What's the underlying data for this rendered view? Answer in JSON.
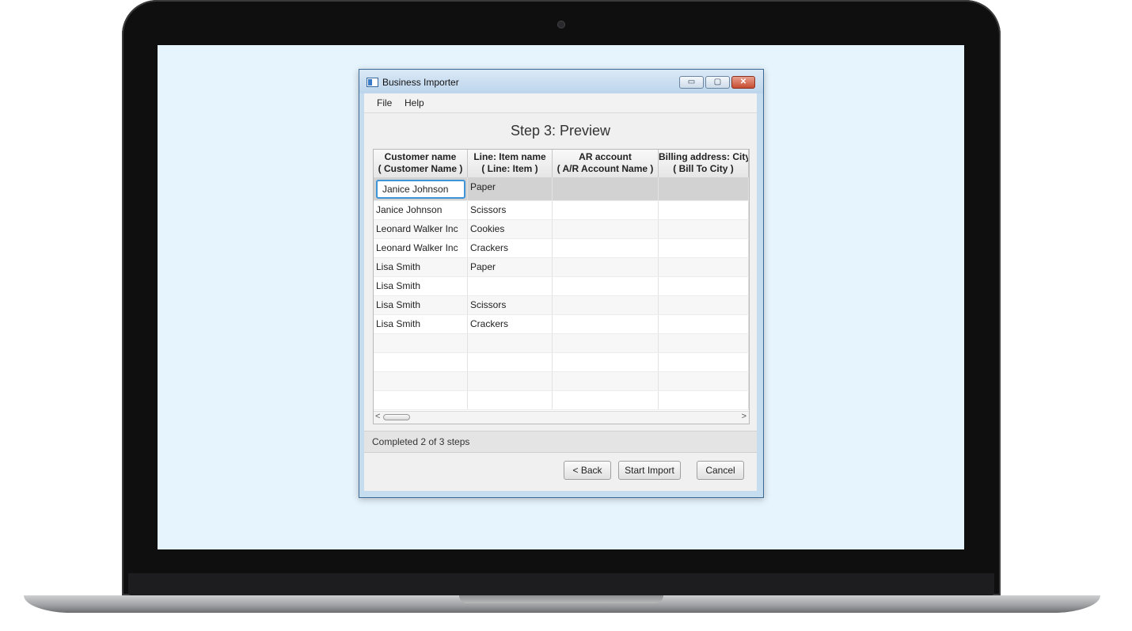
{
  "window": {
    "title": "Business Importer",
    "controls": {
      "minimize": "▭",
      "maximize": "▢",
      "close": "✕"
    }
  },
  "menu": {
    "file": "File",
    "help": "Help"
  },
  "step_title": "Step 3: Preview",
  "table": {
    "columns": [
      {
        "title": "Customer name",
        "sub": "( Customer Name )"
      },
      {
        "title": "Line: Item name",
        "sub": "( Line: Item )"
      },
      {
        "title": "AR account",
        "sub": "( A/R Account Name )"
      },
      {
        "title": "Billing address: City",
        "sub": "( Bill To City )"
      }
    ],
    "editing_value": "Janice Johnson",
    "rows": [
      [
        "Janice Johnson",
        "Paper",
        "",
        ""
      ],
      [
        "Janice Johnson",
        "Scissors",
        "",
        ""
      ],
      [
        "Leonard Walker Inc",
        "Cookies",
        "",
        ""
      ],
      [
        "Leonard Walker Inc",
        "Crackers",
        "",
        ""
      ],
      [
        "Lisa Smith",
        "Paper",
        "",
        ""
      ],
      [
        "Lisa Smith",
        "",
        "",
        ""
      ],
      [
        "Lisa Smith",
        "Scissors",
        "",
        ""
      ],
      [
        "Lisa Smith",
        "Crackers",
        "",
        ""
      ],
      [
        "",
        "",
        "",
        ""
      ],
      [
        "",
        "",
        "",
        ""
      ],
      [
        "",
        "",
        "",
        ""
      ],
      [
        "",
        "",
        "",
        ""
      ]
    ],
    "scroll": {
      "left": "<",
      "right": ">"
    }
  },
  "status": "Completed 2 of 3 steps",
  "buttons": {
    "back": "< Back",
    "start": "Start Import",
    "cancel": "Cancel"
  }
}
